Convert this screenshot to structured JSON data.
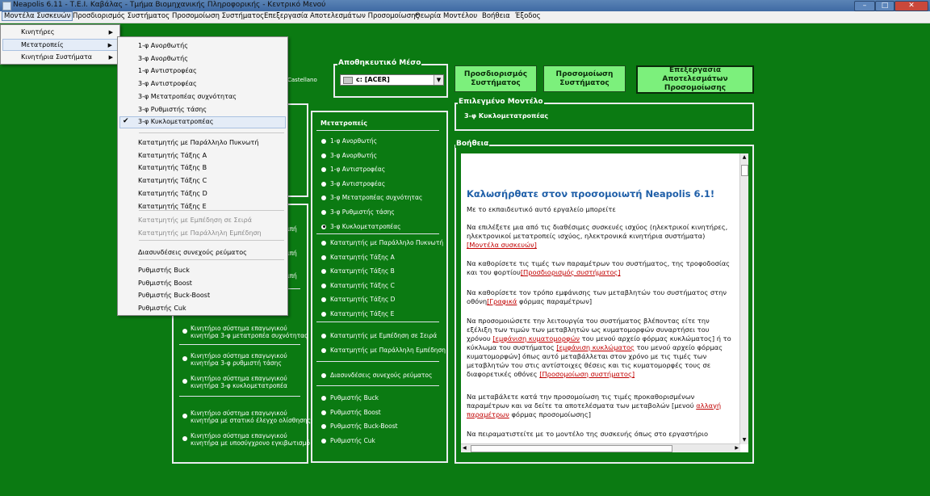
{
  "window": {
    "title": "Neapolis 6.11 - Τ.Ε.Ι. Καβάλας - Τμήμα Βιομηχανικής Πληροφορικής -  Κεντρικό Μενού"
  },
  "menubar": [
    "Μοντέλα Συσκευών",
    "Προσδιορισμός Συστήματος",
    "Προσομοίωση Συστήματος",
    "Επεξεργασία Αποτελεσμάτων Προσομοίωσης",
    "Θεωρία Μοντέλου",
    "Βοήθεια",
    "Έξοδος"
  ],
  "devices_menu": [
    "Κινητήρες",
    "Μετατροπείς",
    "Κινητήρια Συστήματα"
  ],
  "converters_submenu": {
    "group1": [
      "1-φ Ανορθωτής",
      "3-φ Ανορθωτής",
      "1-φ Αντιστροφέας",
      "3-φ Αντιστροφέας",
      "3-φ Μετατροπέας συχνότητας",
      "3-φ Ρυθμιστής τάσης",
      "3-φ Κυκλομετατροπέας"
    ],
    "group2": [
      "Κατατμητής με Παράλληλο Πυκνωτή",
      "Κατατμητής Τάξης A",
      "Κατατμητής Τάξης B",
      "Κατατμητής Τάξης C",
      "Κατατμητής Τάξης D",
      "Κατατμητής Τάξης E"
    ],
    "group3_disabled": [
      "Κατατμητής με Εμπέδηση σε Σειρά",
      "Κατατμητής με Παράλληλη Εμπέδηση"
    ],
    "group4": [
      "Διασυνδέσεις συνεχούς ρεύματος"
    ],
    "group5": [
      "Ρυθμιστής Buck",
      "Ρυθμιστής Boost",
      "Ρυθμιστής Buck-Boost",
      "Ρυθμιστής Cuk"
    ],
    "checked": "3-φ Κυκλομετατροπέας"
  },
  "storage": {
    "label": "Αποθηκευτικό Μέσο",
    "drive_value": "c: [ACER]",
    "partial_text": "Castellano"
  },
  "buttons": {
    "system_definition": [
      "Προσδιορισμός",
      "Συστήματος"
    ],
    "simulation": [
      "Προσομοίωση",
      "Συστήματος"
    ],
    "results": [
      "Επεξεργασία Αποτελεσμάτων",
      "Προσομοίωσης"
    ]
  },
  "selected_model": {
    "label": "Επιλεγμένο Μοντέλο",
    "value": "3-φ Κυκλομετατροπέας"
  },
  "converters_panel": {
    "header": "Μετατροπείς",
    "group1": [
      "1-φ Ανορθωτής",
      "3-φ Ανορθωτής",
      "1-φ Αντιστροφέας",
      "3-φ Αντιστροφέας",
      "3-φ Μετατροπέας συχνότητας",
      "3-φ Ρυθμιστής τάσης",
      "3-φ Κυκλομετατροπέας"
    ],
    "group2": [
      "Κατατμητής με Παράλληλο Πυκνωτή",
      "Κατατμητής Τάξης A",
      "Κατατμητής Τάξης B",
      "Κατατμητής Τάξης C",
      "Κατατμητής Τάξης D",
      "Κατατμητής Τάξης E"
    ],
    "group3": [
      "Κατατμητής με Εμπέδηση σε Σειρά",
      "Κατατμητής με Παράλληλη Εμπέδηση"
    ],
    "group4": [
      "Διασυνδέσεις συνεχούς ρεύματος"
    ],
    "group5": [
      "Ρυθμιστής Buck",
      "Ρυθμιστής Boost",
      "Ρυθμιστής Buck-Boost",
      "Ρυθμιστής Cuk"
    ]
  },
  "drive_systems_visible": {
    "partial": [
      "ιπή",
      "ιπή",
      "ιπή"
    ],
    "items": [
      [
        "Κινητήριο σύστημα επαγωγικού",
        "κινητήρα 3-φ μετατροπέα συχνότητας"
      ],
      [
        "Κινητήριο σύστημα επαγωγικού",
        "κινητήρα 3-φ ρυθμιστή τάσης"
      ],
      [
        "Κινητήριο σύστημα επαγωγικού",
        "κινητήρα 3-φ κυκλομετατροπέα"
      ],
      [
        "Κινητήριο σύστημα επαγωγικού",
        "κινητήρα με στατικό έλεγχο ολίσθησης"
      ],
      [
        "Κινητήριο σύστημα επαγωγικού",
        "κινητήρα με υποσύγχρονο εγκιβωτισμό"
      ]
    ]
  },
  "help": {
    "label": "Βοήθεια",
    "title": "Καλωσήρθατε στον προσομοιωτή Neapolis 6.1!",
    "intro": "Με το εκπαιδευτικό αυτό εργαλείο μπορείτε",
    "p1": "Να επιλέξετε μια από τις διαθέσιμες συσκευές ισχύος (ηλεκτρικοί κινητήρες, ηλεκτρονικοί μετατροπείς ισχύος, ηλεκτρονικά κινητήρια συστήματα)",
    "p1_link": "[Μοντέλα συσκευών]",
    "p2": "Να καθορίσετε τις τιμές των παραμέτρων του συστήματος, της τροφοδοσίας και του φορτίου",
    "p2_link": "[Προσδιορισμός συστήματος]",
    "p3a": "Να καθορίσετε τον τρόπο εμφάνισης των μεταβλητών του συστήματος στην οθόνη",
    "p3_link": "[Γραφικά",
    "p3b": " φόρμας παραμέτρων]",
    "p4a": "Να προσομοιώσετε την λειτουργία του συστήματος βλέποντας είτε την εξέλιξη των τιμών των μεταβλητών ως κυματομορφών συναρτήσει του χρόνου ",
    "p4_link1": "[εμφάνιση κυματομορφών",
    "p4b": " του μενού αρχείο φόρμας κυκλώματος] ή το κύκλωμα του συστήματος ",
    "p4_link2": "[εμφάνιση κυκλώματος",
    "p4c": " του μενού αρχείο φόρμας κυματομορφών] όπως αυτό μεταβάλλεται στον χρόνο με τις τιμές των μεταβλητών του στις αντίστοιχες θέσεις και τις κυματομορφές τους σε διαφορετικές οθόνες ",
    "p4_link3": "[Προσομοίωση συστήματος]",
    "p5a": "Να μεταβάλετε κατά την προσομοίωση τις τιμές προκαθορισμένων παραμέτρων και να δείτε τα αποτελέσματα των μεταβολών [μενού ",
    "p5_link": "αλλαγή παραμέτρων",
    "p5b": " φόρμας προσομοίωσης]",
    "p6": "Να πειραματιστείτε με το μοντέλο της συσκευής όπως στο εργαστήριο"
  },
  "colors": {
    "background": "#0b7a12",
    "button": "#7cf07c",
    "link": "#c00000",
    "help_title": "#1f5fa8"
  }
}
